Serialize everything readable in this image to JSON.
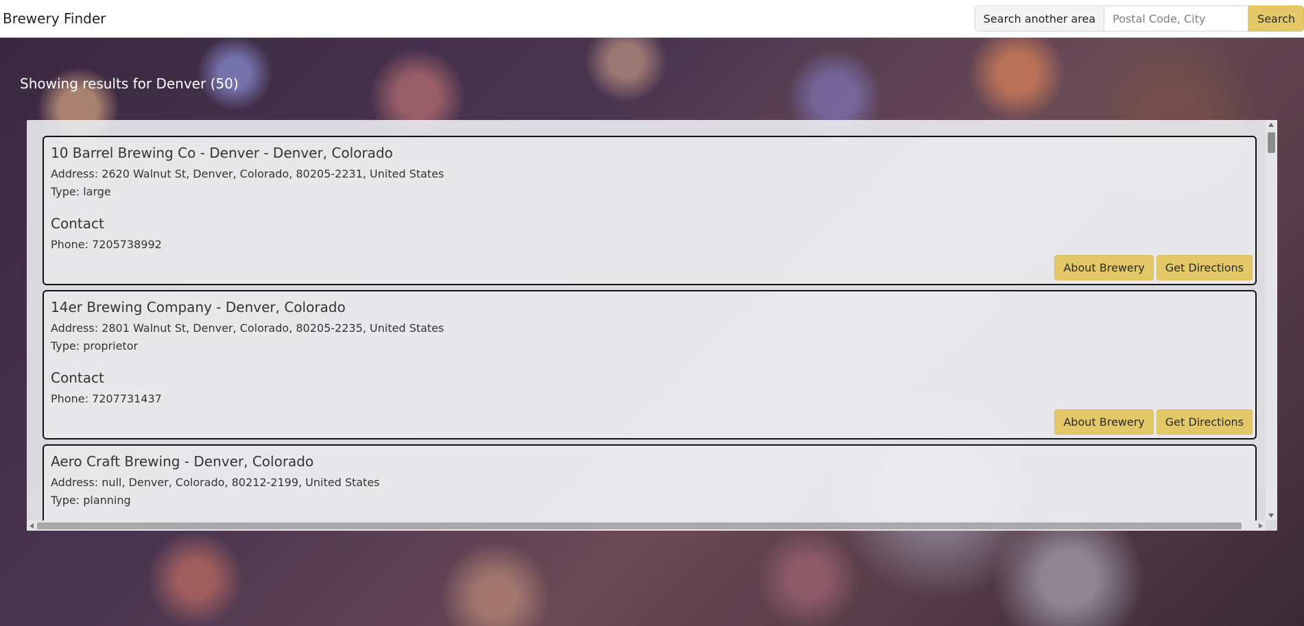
{
  "navbar": {
    "brand": "Brewery Finder",
    "search_area_label": "Search another area",
    "search_placeholder": "Postal Code, City",
    "search_button": "Search"
  },
  "results": {
    "heading": "Showing results for Denver (50)"
  },
  "breweries": [
    {
      "title": "10 Barrel Brewing Co - Denver - Denver, Colorado",
      "address": "Address: 2620 Walnut St, Denver, Colorado, 80205-2231, United States",
      "type": "Type: large",
      "contact_heading": "Contact",
      "phone": "Phone: 7205738992",
      "about_label": "About Brewery",
      "directions_label": "Get Directions"
    },
    {
      "title": "14er Brewing Company - Denver, Colorado",
      "address": "Address: 2801 Walnut St, Denver, Colorado, 80205-2235, United States",
      "type": "Type: proprietor",
      "contact_heading": "Contact",
      "phone": "Phone: 7207731437",
      "about_label": "About Brewery",
      "directions_label": "Get Directions"
    },
    {
      "title": "Aero Craft Brewing - Denver, Colorado",
      "address": "Address: null, Denver, Colorado, 80212-2199, United States",
      "type": "Type: planning"
    }
  ],
  "colors": {
    "accent": "#e4c868",
    "card_border": "#111111"
  }
}
